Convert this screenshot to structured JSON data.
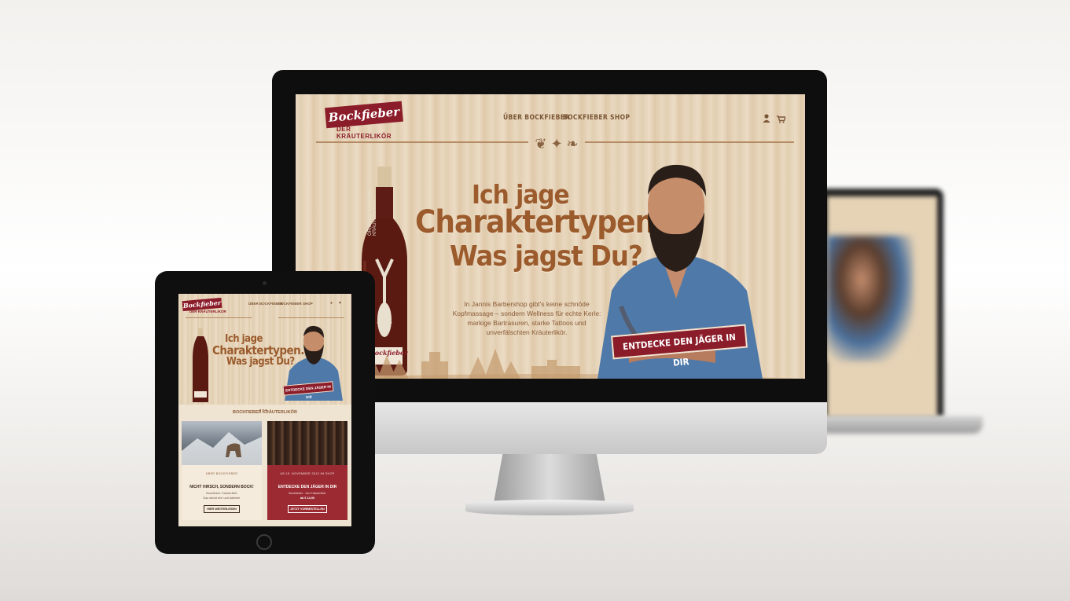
{
  "desktop": {
    "logo": {
      "brand": "Bockfieber",
      "tagline": "DER KRÄUTERLIKÖR"
    },
    "nav": {
      "about": "ÜBER BOCKFIEBER",
      "shop": "BOCKFIEBER SHOP"
    },
    "icons": {
      "account": "user-icon",
      "cart": "cart-icon"
    },
    "hero": {
      "line1": "Ich jage",
      "line2": "Charaktertypen.",
      "line3": "Was jagst Du?",
      "body_lines": [
        "In Jannis Barbershop gibt's keine schnöde",
        "Kopfmassage – sondern Wellness für echte Kerle:",
        "markige Bartrasuren, starke Tattoos und",
        "unverfälschten Kräuterlikör."
      ],
      "cta": "ENTDECKE DEN JÄGER IN DIR",
      "bottle_label": "ORIGINAL BAVARIAN KRÄUTERLIKÖR",
      "bottle_brand": "Bockfieber"
    }
  },
  "tablet": {
    "logo": {
      "brand": "Bockfieber",
      "tagline": "DER KRÄUTERLIKÖR"
    },
    "nav": {
      "about": "ÜBER BOCKFIEBER",
      "shop": "BOCKFIEBER SHOP"
    },
    "hero": {
      "line1": "Ich jage",
      "line2": "Charaktertypen.",
      "line3": "Was jagst Du?",
      "cta": "ENTDECKE DEN JÄGER IN DIR"
    },
    "section_title": "BOCKFIEBER KRÄUTERLIKÖR",
    "cards": [
      {
        "kicker": "ÜBER BOCKFIEBER",
        "title": "NICHT HIRSCH, SONDERN BOCK!",
        "text1": "Bockfieber: Kräuterlikör",
        "text2": "Das steckt drin und dahinter",
        "button": "HIER WEITERLESEN"
      },
      {
        "kicker": "AB 15. NOVEMBER 2013 IM SHOP",
        "title": "ENTDECKE DEN JÄGER IN DIR",
        "text1": "Bockfieber - der Kräuterlikör",
        "text2": "ab € 14,90",
        "button": "JETZT VORBESTELLEN"
      }
    ]
  },
  "colors": {
    "brand_red": "#8b1c2a",
    "wood": "#e6d3b6",
    "headline_brown": "#9b5b2c"
  }
}
